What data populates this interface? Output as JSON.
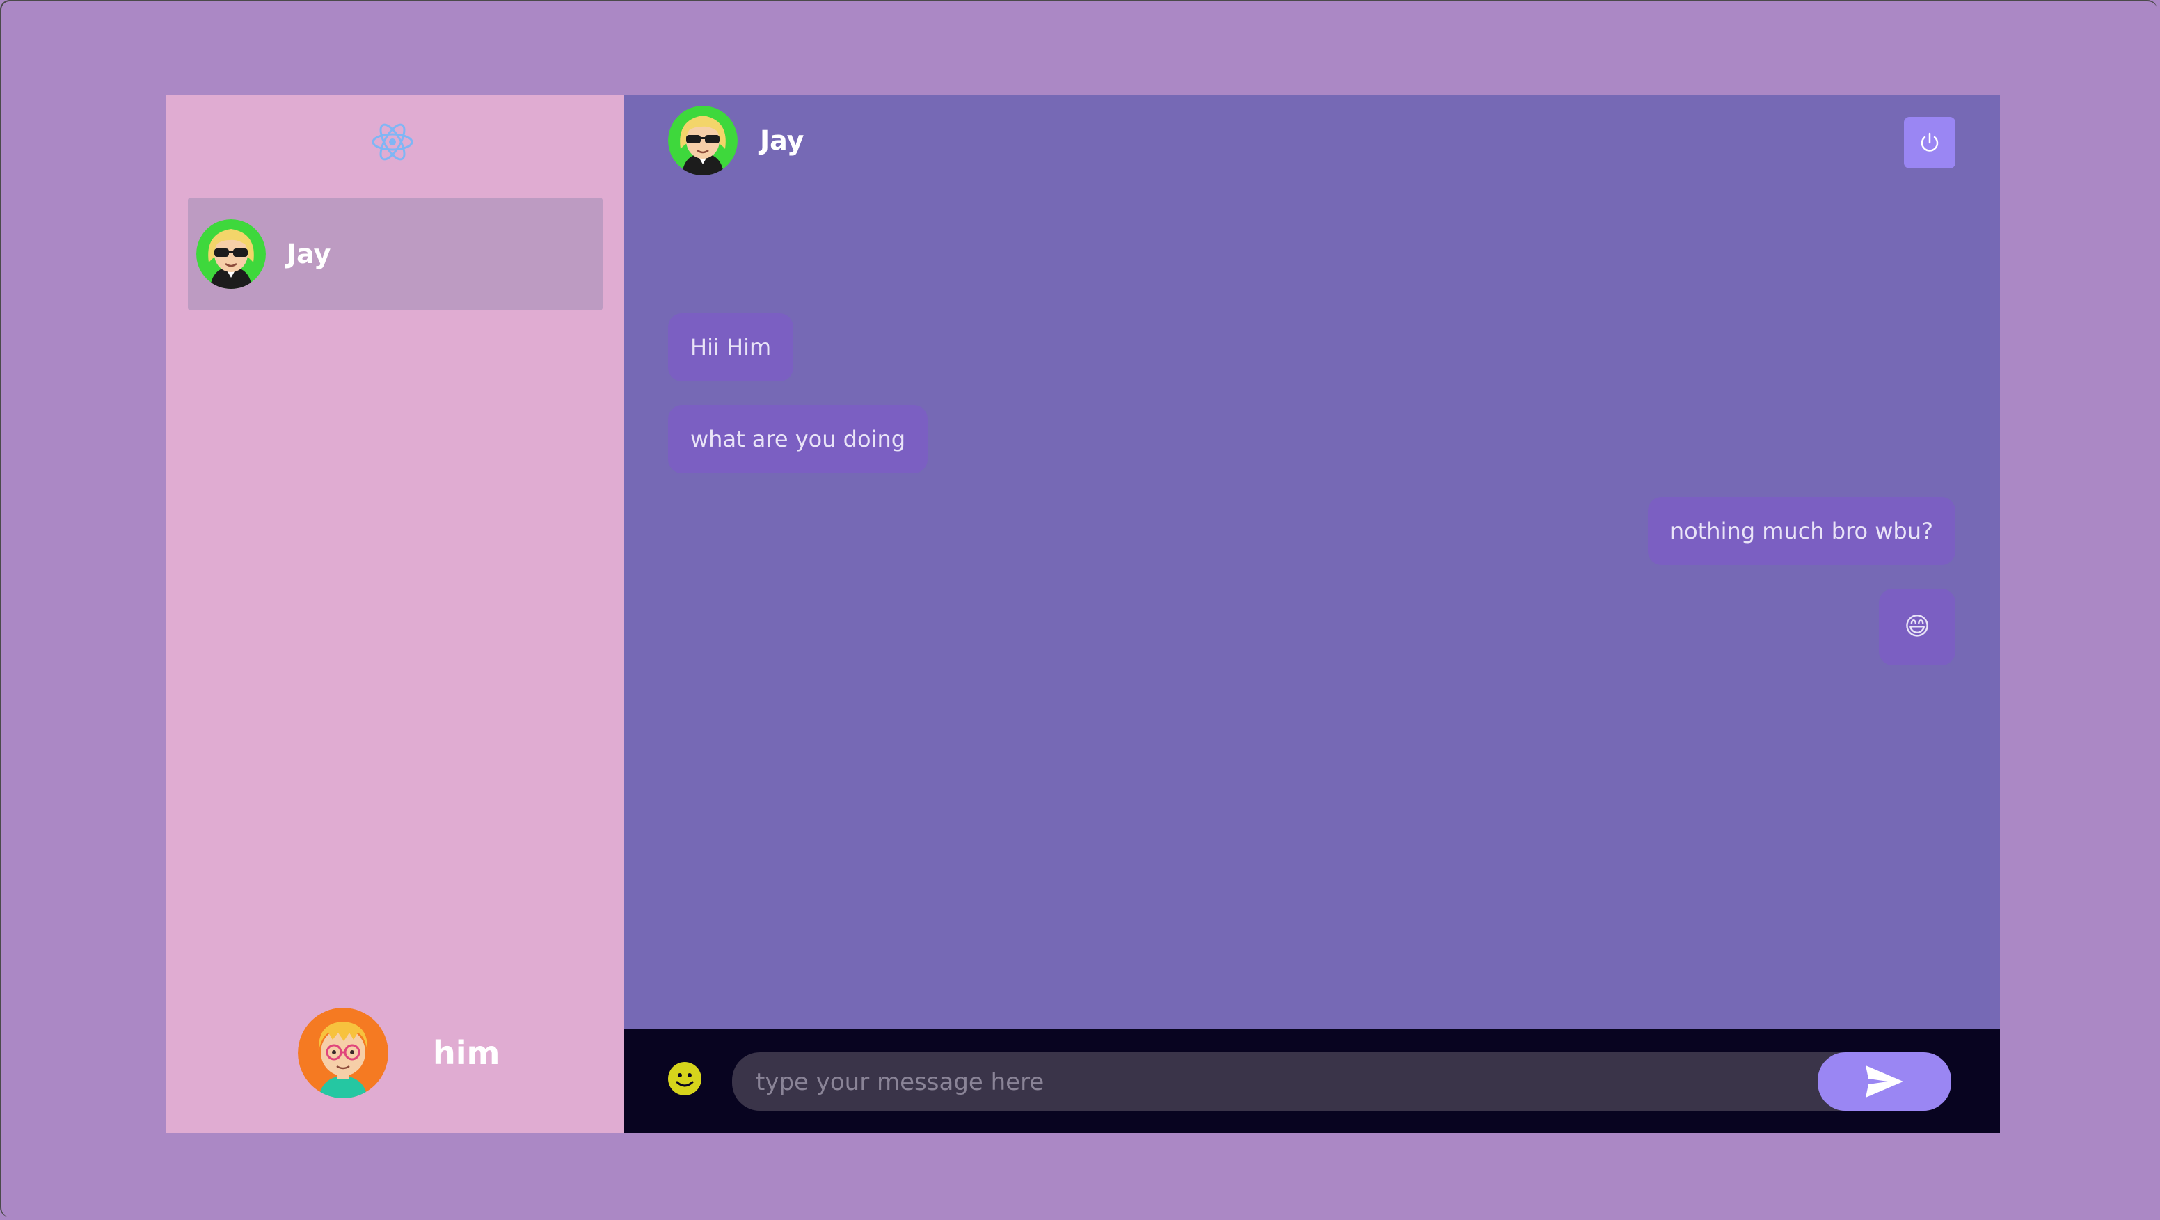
{
  "sidebar": {
    "brand_icon": "react-logo-icon",
    "contacts": [
      {
        "name": "Jay",
        "avatar": "avatar-blonde-sunglasses",
        "selected": true
      }
    ],
    "current_user": {
      "name": "him",
      "avatar": "avatar-orange-glasses"
    }
  },
  "chat": {
    "header": {
      "name": "Jay",
      "avatar": "avatar-blonde-sunglasses"
    },
    "logout_icon": "power-icon",
    "messages": [
      {
        "direction": "received",
        "text": "Hii Him"
      },
      {
        "direction": "received",
        "text": "what are you doing"
      },
      {
        "direction": "sent",
        "text": "nothing much bro wbu?"
      },
      {
        "direction": "sent",
        "text": "😄"
      }
    ]
  },
  "input": {
    "placeholder": "type your message here",
    "value": "",
    "emoji_icon": "smiley-icon",
    "send_icon": "send-icon"
  },
  "colors": {
    "background": "#ab88c5",
    "sidebar": "#e0acd2",
    "sidebar_selected": "#bd9bc2",
    "chat": "#7669b5",
    "bubble": "#7b5fc2",
    "accent": "#9a86f3",
    "input_bar": "#080420",
    "input_field": "#3a3449"
  }
}
